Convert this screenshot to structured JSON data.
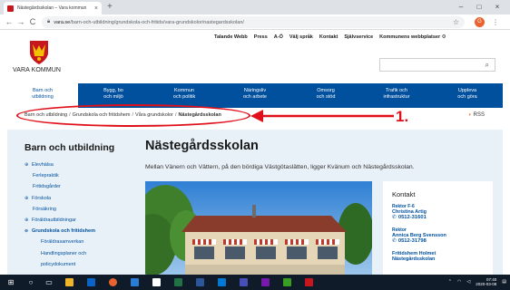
{
  "browser": {
    "tab_title": "Nästegårdsskolan – Vara kommun",
    "tab_close": "×",
    "new_tab": "+",
    "minimize": "–",
    "maximize": "□",
    "close": "×",
    "back": "←",
    "forward": "→",
    "reload": "C",
    "url_host": "vara.se",
    "url_path": "/barn-och-utbildning/grundskola-och-fritids/vara-grundskolor/nastegardsskolan/",
    "star": "☆",
    "profile_initial": "G",
    "menu": "⋮"
  },
  "utility_links": [
    "Talande Webb",
    "Press",
    "A-Ö",
    "Välj språk",
    "Kontakt",
    "Självservice",
    "Kommunens webbplatser ⚙"
  ],
  "logo": {
    "text": "VARA KOMMUN"
  },
  "search": {
    "placeholder": "",
    "icon": "⌕"
  },
  "main_nav": [
    {
      "line1": "Barn och",
      "line2": "utbildning"
    },
    {
      "line1": "Bygg, bo",
      "line2": "och miljö"
    },
    {
      "line1": "Kommun",
      "line2": "och politik"
    },
    {
      "line1": "Näringsliv",
      "line2": "och arbete"
    },
    {
      "line1": "Omsorg",
      "line2": "och stöd"
    },
    {
      "line1": "Trafik och",
      "line2": "infrastruktur"
    },
    {
      "line1": "Uppleva",
      "line2": "och göra"
    }
  ],
  "breadcrumb": {
    "items": [
      "Barn och utbildning",
      "Grundskola och fritidshem",
      "Våra grundskolor"
    ],
    "current": "Nästegårdsskolan",
    "separator": "/"
  },
  "rss": {
    "label": "RSS"
  },
  "annotation": {
    "number": "1."
  },
  "sidebar": {
    "title": "Barn och utbildning",
    "items": [
      {
        "label": "Elevhälsa",
        "level": 1,
        "bullet": "⊕"
      },
      {
        "label": "Ferlepraktik",
        "level": 2,
        "bullet": ""
      },
      {
        "label": "Fritidsgårder",
        "level": 2,
        "bullet": ""
      },
      {
        "label": "Förskola",
        "level": 1,
        "bullet": "⊕"
      },
      {
        "label": "Försäkring",
        "level": 2,
        "bullet": ""
      },
      {
        "label": "Föräldrautbildningar",
        "level": 1,
        "bullet": "⊕"
      },
      {
        "label": "Grundskola och fritidshem",
        "level": 1,
        "bullet": "⊖",
        "bold": true
      },
      {
        "label": "Föräldrasamverkan",
        "level": 3,
        "bullet": ""
      },
      {
        "label": "Handlingsplaner och",
        "level": 3,
        "bullet": ""
      },
      {
        "label": "policydokument",
        "level": 3,
        "bullet": ""
      }
    ]
  },
  "main": {
    "title": "Nästegårdsskolan",
    "lead": "Mellan Vänern och Vättern, på den bördiga Västgötaslätten, ligger Kvänum  och Nästegårdsskolan."
  },
  "contact": {
    "title": "Kontakt",
    "entries": [
      {
        "role": "Rektor F-6",
        "name": "Christina Artig",
        "phone": "0512-31601"
      },
      {
        "role": "Rektor",
        "name": "Annica Berg Svensson",
        "phone": "0512-31798"
      },
      {
        "role": "",
        "name": "Fritidshem Holmet",
        "phone": "Nästegårdsskolan"
      }
    ]
  },
  "taskbar": {
    "clock_time": "07:40",
    "clock_date": "2020-03-08"
  },
  "colors": {
    "brand_blue": "#00509e",
    "annotation_red": "#e0101a",
    "panel_bg": "#e8f1f8"
  }
}
